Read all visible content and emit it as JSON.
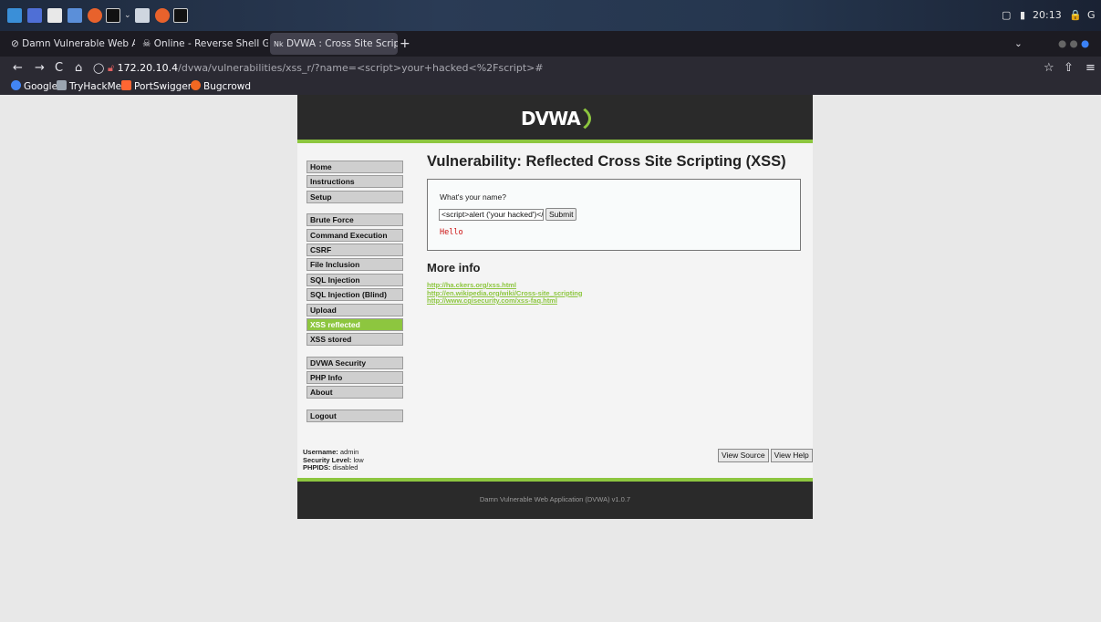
{
  "taskbar": {
    "time": "20:13",
    "icons": [
      "kali-menu-icon",
      "desktop-icon",
      "files-icon",
      "editor-icon",
      "firefox-icon",
      "terminal-icon",
      "screen-icon",
      "firefox-icon",
      "terminal-icon"
    ]
  },
  "tabs": [
    {
      "label": "Damn Vulnerable Web Ap",
      "icon": "dvwa-icon"
    },
    {
      "label": "Online - Reverse Shell Ge",
      "icon": "skull-icon"
    },
    {
      "label": "DVWA : Cross Site Scripti",
      "icon": "dvwa-icon"
    }
  ],
  "address": {
    "host": "172.20.10.4",
    "path": "/dvwa/vulnerabilities/xss_r/?name=<script>your+hacked<%2Fscript>#"
  },
  "bookmarks": [
    {
      "label": "Google",
      "color": "#4285f4"
    },
    {
      "label": "TryHackMe",
      "color": "#9aa4b0"
    },
    {
      "label": "PortSwigger",
      "color": "#ff6633"
    },
    {
      "label": "Bugcrowd",
      "color": "#f26822"
    }
  ],
  "dvwa": {
    "logo": "DVWA",
    "menu_top": [
      "Home",
      "Instructions",
      "Setup"
    ],
    "menu_vulns": [
      "Brute Force",
      "Command Execution",
      "CSRF",
      "File Inclusion",
      "SQL Injection",
      "SQL Injection (Blind)",
      "Upload",
      "XSS reflected",
      "XSS stored"
    ],
    "menu_bottom": [
      "DVWA Security",
      "PHP Info",
      "About"
    ],
    "logout": "Logout",
    "title": "Vulnerability: Reflected Cross Site Scripting (XSS)",
    "form_label": "What's your name?",
    "input_value": "<script>alert ('your hacked')</",
    "submit": "Submit",
    "hello": "Hello",
    "more_info": "More info",
    "links": [
      "http://ha.ckers.org/xss.html",
      "http://en.wikipedia.org/wiki/Cross-site_scripting",
      "http://www.cgisecurity.com/xss-faq.html"
    ],
    "username_label": "Username:",
    "username": "admin",
    "security_label": "Security Level:",
    "security": "low",
    "phpids_label": "PHPIDS:",
    "phpids": "disabled",
    "view_source": "View Source",
    "view_help": "View Help",
    "footer": "Damn Vulnerable Web Application (DVWA) v1.0.7",
    "accent": "#8dc63f"
  }
}
